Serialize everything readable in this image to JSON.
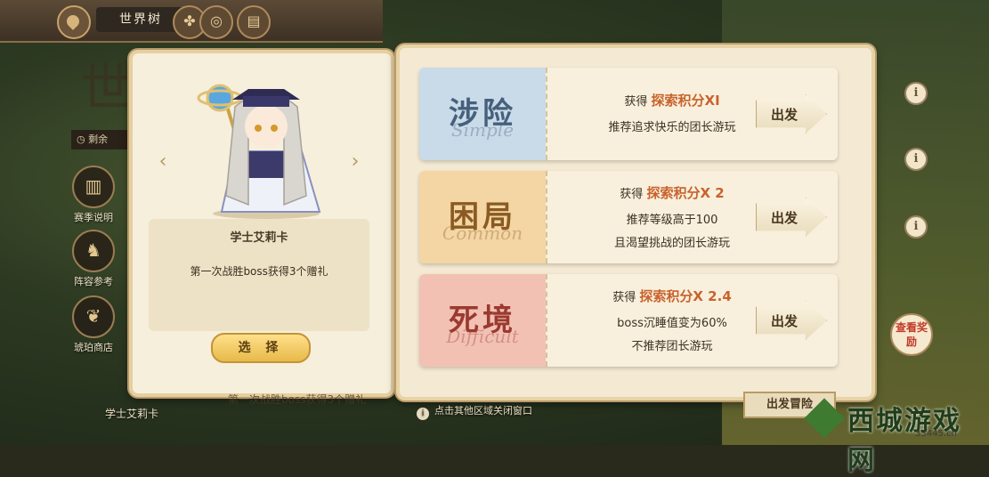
{
  "header": {
    "title": "世界树",
    "icons": [
      "back-icon",
      "clover-icon",
      "compass-icon",
      "book-icon"
    ]
  },
  "side_nav": [
    {
      "label": "赛季说明",
      "icon": "book-icon"
    },
    {
      "label": "阵容参考",
      "icon": "team-icon"
    },
    {
      "label": "琥珀商店",
      "icon": "shop-icon"
    }
  ],
  "character": {
    "name": "学士艾莉卡",
    "description": "第一次战胜boss获得3个赠礼",
    "select_label": "选 择"
  },
  "difficulties": [
    {
      "name": "涉险",
      "name_en": "Simple",
      "color": "#c9dbe8",
      "text_color": "#46607c",
      "reward_prefix": "获得",
      "reward": "探索积分XI",
      "lines": [
        "推荐追求快乐的团长游玩"
      ],
      "go_label": "出发"
    },
    {
      "name": "困局",
      "name_en": "Common",
      "color": "#f3d6a4",
      "text_color": "#8a5a22",
      "reward_prefix": "获得",
      "reward": "探索积分X 2",
      "lines": [
        "推荐等级高于100",
        "且渴望挑战的团长游玩"
      ],
      "go_label": "出发"
    },
    {
      "name": "死境",
      "name_en": "Difficult",
      "color": "#f2c1b4",
      "text_color": "#9a3a30",
      "reward_prefix": "获得",
      "reward": "探索积分X 2.4",
      "lines": [
        "boss沉睡值变为60%",
        "不推荐团长游玩"
      ],
      "go_label": "出发"
    }
  ],
  "hint": "点击其他区域关闭窗口",
  "bottom": {
    "character_name": "学士艾莉卡",
    "description": "第一次战胜boss获得3个赠礼",
    "depart_label": "出发冒险",
    "reward_label": "查看奖励"
  },
  "watermark": {
    "name": "西城游戏网",
    "url": "33445.cn"
  }
}
